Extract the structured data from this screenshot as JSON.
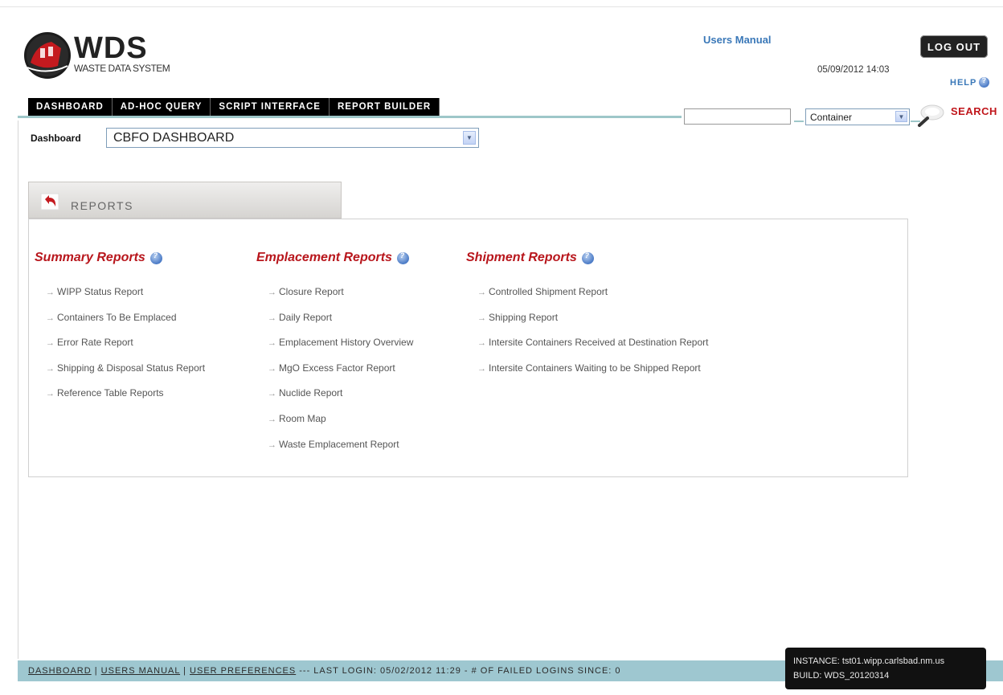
{
  "app": {
    "logo_title": "WDS",
    "logo_subtitle": "WASTE DATA SYSTEM"
  },
  "header": {
    "users_manual": "Users Manual",
    "datetime": "05/09/2012 14:03",
    "logout": "LOG OUT",
    "help": "HELP",
    "search_type": "Container",
    "search_label": "SEARCH"
  },
  "nav": {
    "tabs": [
      "DASHBOARD",
      "AD-HOC QUERY",
      "SCRIPT INTERFACE",
      "REPORT BUILDER"
    ]
  },
  "dashboard": {
    "label": "Dashboard",
    "selected": "CBFO DASHBOARD"
  },
  "reports": {
    "tab_label": "REPORTS",
    "columns": [
      {
        "title": "Summary Reports",
        "items": [
          "WIPP Status Report",
          "Containers To Be Emplaced",
          "Error Rate Report",
          "Shipping & Disposal Status Report",
          "Reference Table Reports"
        ]
      },
      {
        "title": "Emplacement Reports",
        "items": [
          "Closure Report",
          "Daily Report",
          "Emplacement History Overview",
          "MgO Excess Factor Report",
          "Nuclide Report",
          "Room Map",
          "Waste Emplacement Report"
        ]
      },
      {
        "title": "Shipment Reports",
        "items": [
          "Controlled Shipment Report",
          "Shipping Report",
          "Intersite Containers Received at Destination Report",
          "Intersite Containers Waiting to be Shipped Report"
        ]
      }
    ]
  },
  "footer": {
    "dashboard": "DASHBOARD",
    "users_manual": "USERS MANUAL",
    "user_preferences": "USER PREFERENCES",
    "sep": " | ",
    "last_login": " --- LAST LOGIN: 05/02/2012 11:29 - # OF FAILED LOGINS SINCE: 0"
  },
  "instance": {
    "instance": "INSTANCE: tst01.wipp.carlsbad.nm.us",
    "build": "BUILD: WDS_20120314"
  },
  "colors": {
    "accent_red": "#b8161c",
    "link_blue": "#3a78b8",
    "rule_teal": "#9ec7c9"
  }
}
